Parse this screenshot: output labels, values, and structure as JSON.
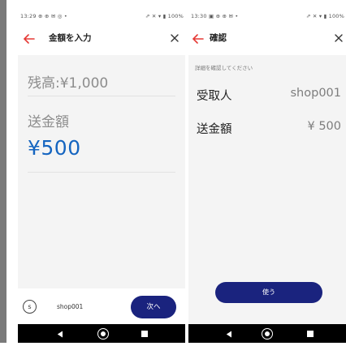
{
  "left_screen": {
    "status_bar": {
      "time": "13:29",
      "icons": "⊕ ⊕ ✉ ◎ •",
      "right": "⇗ ✕ ▾ ▮ 100%"
    },
    "app_bar": {
      "title": "金額を入力",
      "back_icon": "back-arrow-icon",
      "close_icon": "close-icon"
    },
    "balance_text": "残高:¥1,000",
    "amount_label": "送金額",
    "amount_value": "¥500",
    "recipient": {
      "badge": "s",
      "name": "shop001"
    },
    "next_button_label": "次へ"
  },
  "right_screen": {
    "status_bar": {
      "time": "13:30",
      "icons": "▣ ⊕ ⊕ ✉ •",
      "right": "⇗ ✕ ▾ ▮ 100%"
    },
    "app_bar": {
      "title": "確認",
      "back_icon": "back-arrow-icon",
      "close_icon": "close-icon"
    },
    "subtitle": "詳細を確認してください",
    "details": [
      {
        "label": "受取人",
        "value": "shop001"
      },
      {
        "label": "送金額",
        "value": "¥ 500"
      }
    ],
    "use_button_label": "使う"
  },
  "colors": {
    "accent_red": "#e53935",
    "primary_navy": "#1a237e",
    "amount_blue": "#1565c0",
    "content_bg": "#f4f4f4"
  }
}
